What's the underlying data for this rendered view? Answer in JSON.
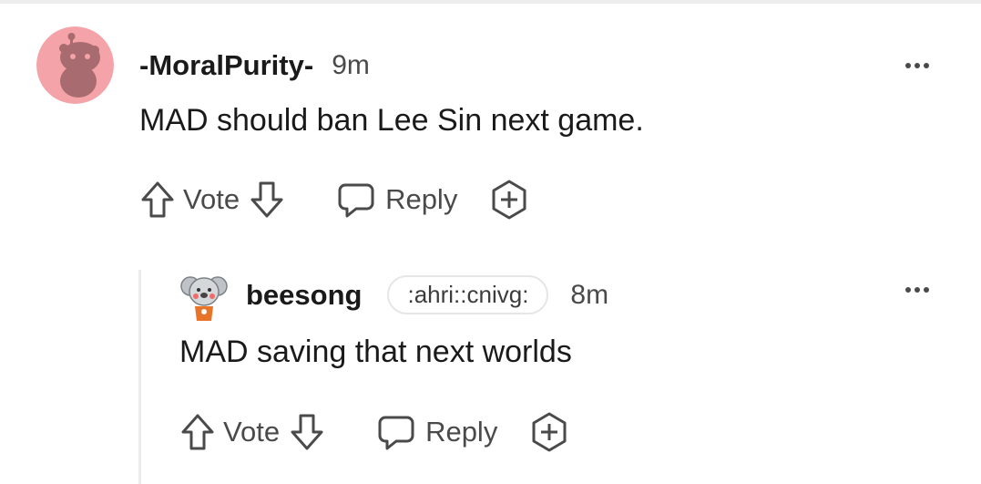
{
  "comments": [
    {
      "username": "-MoralPurity-",
      "time": "9m",
      "body": "MAD should ban Lee Sin next game.",
      "vote_label": "Vote",
      "reply_label": "Reply"
    },
    {
      "username": "beesong",
      "flair": ":ahri::cnivg:",
      "time": "8m",
      "body": "MAD saving that next worlds",
      "vote_label": "Vote",
      "reply_label": "Reply"
    }
  ],
  "icons": {
    "avatar1": "snoo-avatar-icon",
    "avatar2": "koala-avatar-icon",
    "upvote": "upvote-arrow-icon",
    "downvote": "downvote-arrow-icon",
    "reply": "speech-bubble-icon",
    "award": "award-plus-icon",
    "more": "more-options-icon"
  },
  "colors": {
    "avatar1_bg": "#f4a3a8",
    "text": "#1a1a1b",
    "muted": "#4a4a4a",
    "thread_line": "#ececec"
  }
}
